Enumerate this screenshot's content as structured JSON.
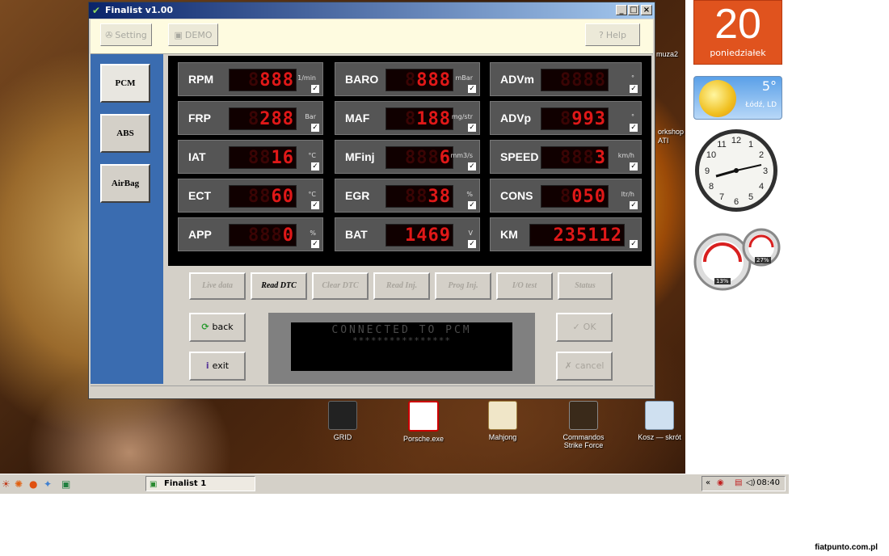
{
  "window": {
    "title": "Finalist v1.00",
    "min": "_",
    "max": "□",
    "close": "×"
  },
  "toolbar": {
    "setting": "Setting",
    "demo": "DEMO",
    "help": "Help"
  },
  "nav": {
    "pcm": "PCM",
    "abs": "ABS",
    "airbag": "AirBag"
  },
  "gauges": [
    {
      "label": "RPM",
      "ghost": "8",
      "value": "888",
      "unit": "1/min",
      "checked": "✓"
    },
    {
      "label": "BARO",
      "ghost": "8",
      "value": "888",
      "unit": "mBar",
      "checked": "✓"
    },
    {
      "label": "ADVm",
      "ghost": "8888",
      "value": "",
      "unit": "°",
      "checked": "✓"
    },
    {
      "label": "FRP",
      "ghost": "8",
      "value": "288",
      "unit": "Bar",
      "checked": "✓"
    },
    {
      "label": "MAF",
      "ghost": "8",
      "value": "188",
      "unit": "mg/str",
      "checked": "✓"
    },
    {
      "label": "ADVp",
      "ghost": "8",
      "value": "993",
      "unit": "°",
      "checked": "✓"
    },
    {
      "label": "IAT",
      "ghost": "88",
      "value": "16",
      "unit": "°C",
      "checked": "✓"
    },
    {
      "label": "MFinj",
      "ghost": "888",
      "value": "6",
      "unit": "mm3/s",
      "checked": "✓"
    },
    {
      "label": "SPEED",
      "ghost": "888",
      "value": "3",
      "unit": "km/h",
      "checked": "✓"
    },
    {
      "label": "ECT",
      "ghost": "88",
      "value": "60",
      "unit": "°C",
      "checked": "✓"
    },
    {
      "label": "EGR",
      "ghost": "88",
      "value": "38",
      "unit": "%",
      "checked": "✓"
    },
    {
      "label": "CONS",
      "ghost": "8",
      "value": "050",
      "unit": "ltr/h",
      "checked": "✓"
    },
    {
      "label": "APP",
      "ghost": "888",
      "value": "0",
      "unit": "%",
      "checked": "✓"
    },
    {
      "label": "BAT",
      "ghost": "",
      "value": "1469",
      "unit": "V",
      "checked": "✓"
    },
    {
      "label": "KM",
      "ghost": "",
      "value": "235112",
      "unit": "",
      "checked": "✓"
    }
  ],
  "actions": {
    "live_data": "Live data",
    "read_dtc": "Read DTC",
    "clear_dtc": "Clear DTC",
    "read_inj": "Read Inj.",
    "prog_inj": "Prog Inj.",
    "io_test": "I/O test",
    "status": "Status"
  },
  "controls": {
    "back": "back",
    "exit": "exit",
    "ok": "OK",
    "cancel": "cancel"
  },
  "lcd": {
    "line1": "CONNECTED TO PCM",
    "line2": "****************"
  },
  "desktop": {
    "date_num": "20",
    "date_day": "poniedziałek",
    "temp": "5°",
    "city": "Łódź, LD",
    "speed_pct1": "13%",
    "speed_pct2": "27%",
    "icon_muza": "muza2",
    "icon_ati": "orkshop\nATI",
    "icons": [
      {
        "label": "GRID"
      },
      {
        "label": "Porsche.exe"
      },
      {
        "label": "Mahjong"
      },
      {
        "label": "Commandos Strike Force"
      },
      {
        "label": "Kosz — skrót"
      }
    ]
  },
  "taskbar": {
    "task": "Finalist 1",
    "time": "08:40",
    "tray_expand": "«"
  },
  "watermark": "fiatpunto.com.pl",
  "colors": {
    "display_red": "#e01818",
    "nav_blue": "#3a6cb0",
    "tile_orange": "#e0531e"
  }
}
